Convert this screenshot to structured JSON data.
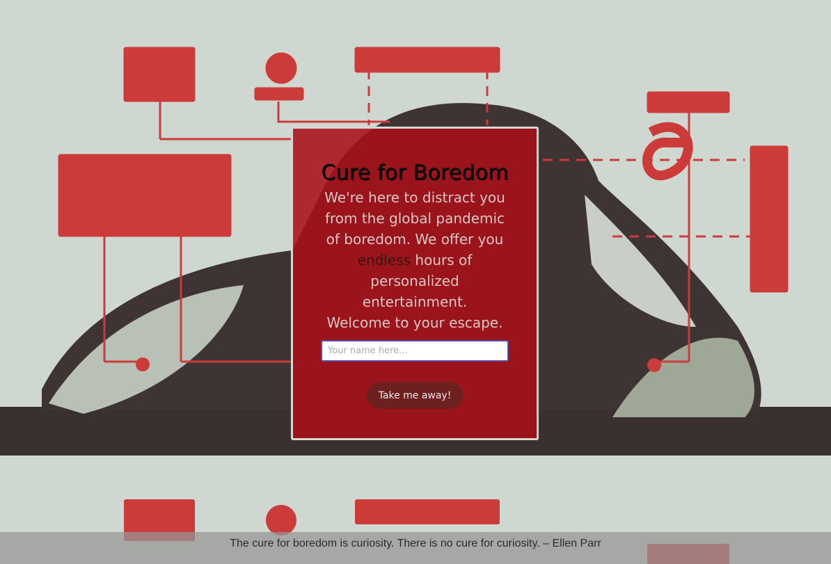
{
  "background": {
    "description_icon": "illustration-bored-person-machines",
    "colors": {
      "paper": "#cfd8d0",
      "accent": "#cc3a3a",
      "ink": "#3a3232"
    }
  },
  "card": {
    "title": "Cure for Boredom",
    "tagline_part1": "We're here to distract you from the global pandemic of boredom. We offer you ",
    "tagline_emphasis": "endless",
    "tagline_part2": " hours of personalized entertainment.",
    "tagline_line2": "Welcome to your escape.",
    "name_placeholder": "Your name here...",
    "name_value": "",
    "button_label": "Take me away!",
    "background_color": "#aa1018"
  },
  "footer": {
    "quote": "The cure for boredom is curiosity. There is no cure for curiosity. – Ellen Parr"
  }
}
